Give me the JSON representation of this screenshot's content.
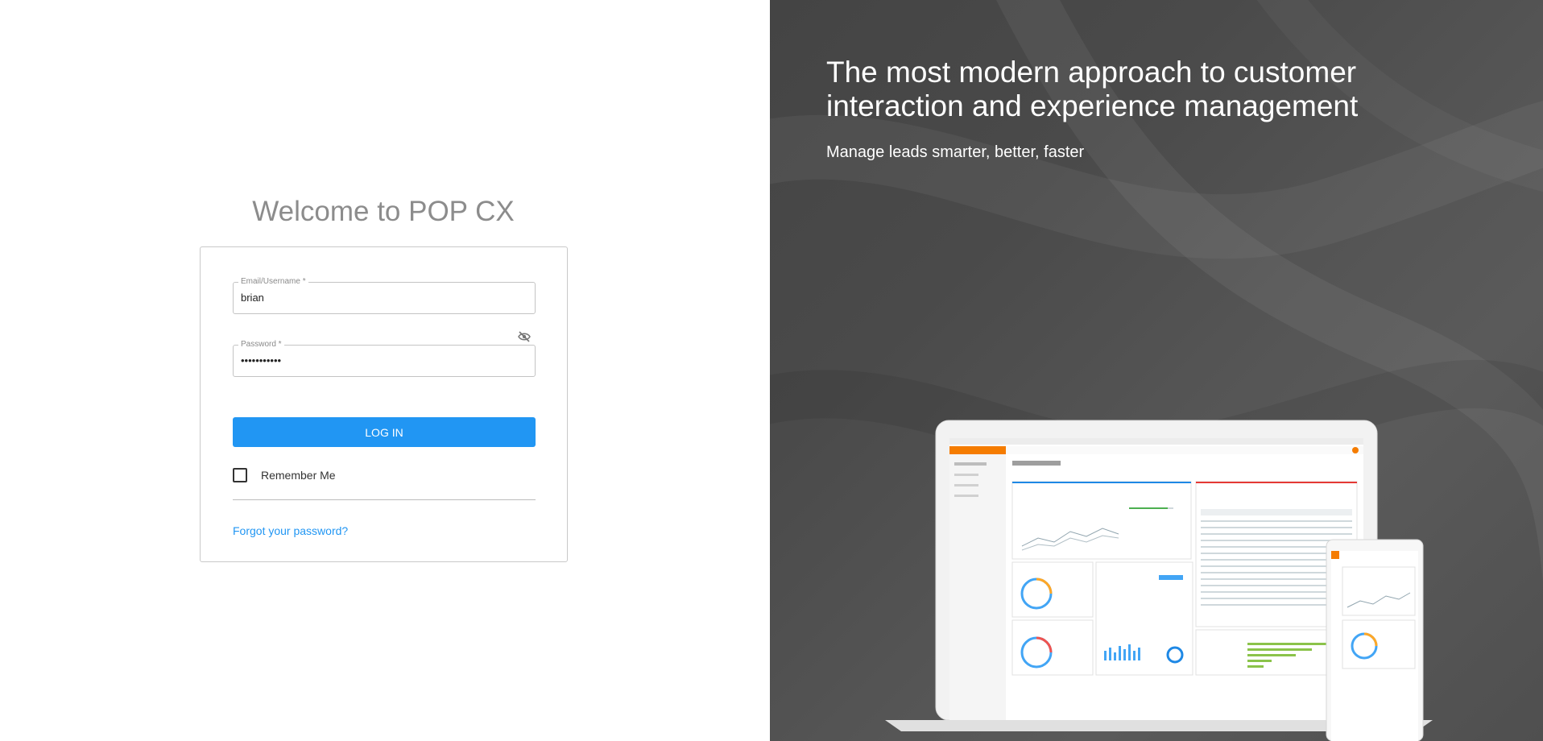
{
  "login": {
    "welcome": "Welcome to POP CX",
    "email_label": "Email/Username *",
    "email_value": "brian",
    "password_label": "Password *",
    "password_value": "•••••••••••",
    "login_label": "LOG IN",
    "remember_label": "Remember Me",
    "remember_checked": false,
    "forgot_label": "Forgot your password?"
  },
  "promo": {
    "headline": "The most modern approach to customer interaction and experience management",
    "subline": "Manage leads smarter, better, faster"
  },
  "colors": {
    "primary": "#2196f3",
    "panel_dark": "#4a4a4a",
    "accent_orange": "#f57c00"
  }
}
